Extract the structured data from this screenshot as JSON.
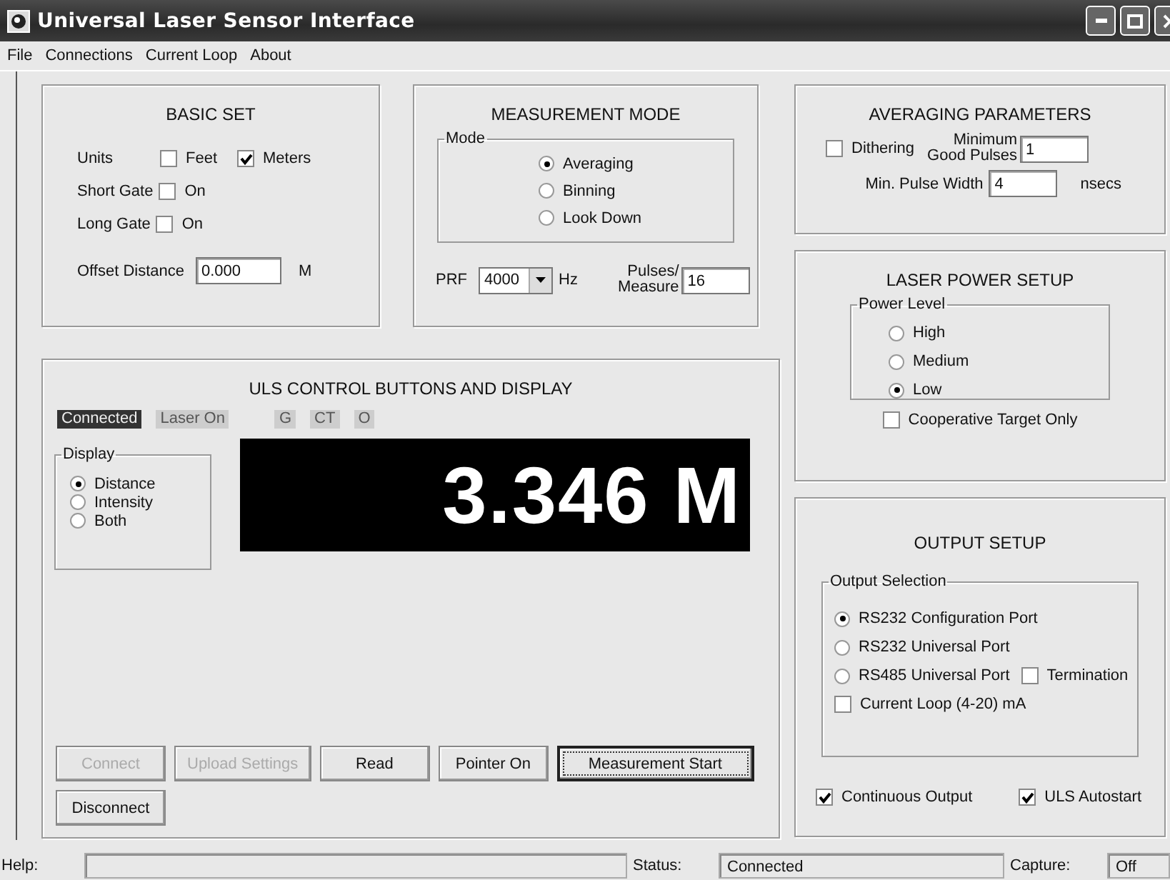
{
  "window": {
    "title": "Universal Laser Sensor Interface"
  },
  "menu": [
    "File",
    "Connections",
    "Current Loop",
    "About"
  ],
  "basic_set": {
    "title": "BASIC SET",
    "units_label": "Units",
    "units": [
      {
        "label": "Feet",
        "checked": false
      },
      {
        "label": "Meters",
        "checked": true
      }
    ],
    "gates": [
      {
        "label": "Short Gate",
        "option": "On",
        "checked": false
      },
      {
        "label": "Long Gate",
        "option": "On",
        "checked": false
      }
    ],
    "offset": {
      "label": "Offset Distance",
      "value": "0.000",
      "unit": "M"
    }
  },
  "measurement_mode": {
    "title": "MEASUREMENT MODE",
    "group": "Mode",
    "modes": [
      {
        "label": "Averaging",
        "selected": true
      },
      {
        "label": "Binning",
        "selected": false
      },
      {
        "label": "Look Down",
        "selected": false
      }
    ],
    "prf": {
      "label": "PRF",
      "value": "4000",
      "unit": "Hz"
    },
    "pulses": {
      "label_lines": [
        "Pulses/",
        "Measure"
      ],
      "value": "16"
    }
  },
  "averaging": {
    "title": "AVERAGING PARAMETERS",
    "dithering": {
      "label": "Dithering",
      "checked": false
    },
    "min_good_pulses": {
      "label_lines": [
        "Minimum",
        "Good Pulses"
      ],
      "value": "1"
    },
    "min_pulse_width": {
      "label": "Min. Pulse Width",
      "value": "4",
      "unit": "nsecs"
    }
  },
  "laser_power": {
    "title": "LASER POWER SETUP",
    "group": "Power Level",
    "levels": [
      {
        "label": "High",
        "selected": false
      },
      {
        "label": "Medium",
        "selected": false
      },
      {
        "label": "Low",
        "selected": true
      }
    ],
    "cooperative": {
      "label": "Cooperative Target Only",
      "checked": false
    }
  },
  "control": {
    "title": "ULS CONTROL BUTTONS AND DISPLAY",
    "indicators": [
      {
        "label": "Connected",
        "on": true
      },
      {
        "label": "Laser On",
        "on": false
      },
      {
        "label": "G",
        "on": false
      },
      {
        "label": "CT",
        "on": false
      },
      {
        "label": "O",
        "on": false
      }
    ],
    "display_group": "Display",
    "display_modes": [
      {
        "label": "Distance",
        "selected": true
      },
      {
        "label": "Intensity",
        "selected": false
      },
      {
        "label": "Both",
        "selected": false
      }
    ],
    "reading": "3.346 M",
    "buttons": [
      {
        "label": "Connect",
        "disabled": true,
        "default": false
      },
      {
        "label": "Upload Settings",
        "disabled": true,
        "default": false
      },
      {
        "label": "Read",
        "disabled": false,
        "default": false
      },
      {
        "label": "Pointer On",
        "disabled": false,
        "default": false
      },
      {
        "label": "Measurement Start",
        "disabled": false,
        "default": true
      },
      {
        "label": "Disconnect",
        "disabled": false,
        "default": false
      }
    ]
  },
  "output": {
    "title": "OUTPUT SETUP",
    "group": "Output Selection",
    "ports": [
      {
        "label": "RS232 Configuration Port",
        "selected": true
      },
      {
        "label": "RS232 Universal Port",
        "selected": false
      },
      {
        "label": "RS485 Universal Port",
        "selected": false
      }
    ],
    "termination": {
      "label": "Termination",
      "checked": false
    },
    "current_loop": {
      "label": "Current Loop (4-20) mA",
      "checked": false
    },
    "options": [
      {
        "label": "Continuous Output",
        "checked": true
      },
      {
        "label": "ULS Autostart",
        "checked": true
      }
    ]
  },
  "status_bar": {
    "help_label": "Help:",
    "status_label": "Status:",
    "status": "Connected",
    "capture_label": "Capture:",
    "capture": "Off"
  }
}
